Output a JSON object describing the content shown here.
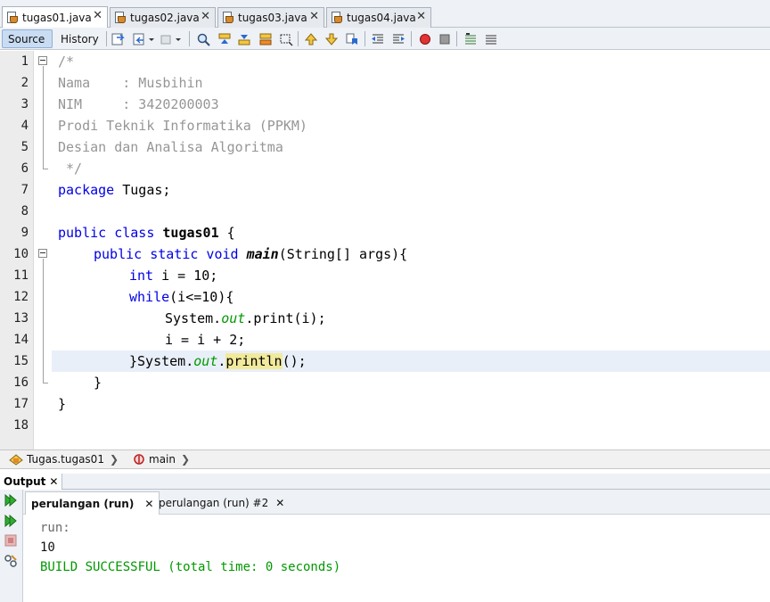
{
  "file_tabs": [
    {
      "label": "tugas01.java",
      "close": "✕"
    },
    {
      "label": "tugas02.java",
      "close": "✕"
    },
    {
      "label": "tugas03.java",
      "close": "✕"
    },
    {
      "label": "tugas04.java",
      "close": "✕"
    }
  ],
  "toolbar": {
    "source_label": "Source",
    "history_label": "History"
  },
  "editor": {
    "line_numbers": [
      "1",
      "2",
      "3",
      "4",
      "5",
      "6",
      "7",
      "8",
      "9",
      "10",
      "11",
      "12",
      "13",
      "14",
      "15",
      "16",
      "17",
      "18"
    ],
    "lines": {
      "l1": "/*",
      "l2": "Nama    : Musbihin",
      "l3": "NIM     : 3420200003",
      "l4": "Prodi Teknik Informatika (PPKM)",
      "l5": "Desian dan Analisa Algoritma",
      "l6": " */",
      "l7_kw": "package",
      "l7_rest": " Tugas;",
      "l9_kw": "public class",
      "l9_name": "tugas01",
      "l9_rest": " {",
      "l10_kw": "public static void",
      "l10_name": "main",
      "l10_rest": "(String[] args){",
      "l11_kw": "int",
      "l11_rest": " i = 10;",
      "l12_kw": "while",
      "l12_rest": "(i<=10){",
      "l13_a": "System.",
      "l13_out": "out",
      "l13_b": ".print(i);",
      "l14": "i = i + 2;",
      "l15_a": "}System.",
      "l15_out": "out",
      "l15_dot": ".",
      "l15_hl": "println",
      "l15_b": "();",
      "l16": "}",
      "l17": "}"
    }
  },
  "breadcrumb": {
    "class_label": "Tugas.tugas01",
    "method_label": "main",
    "sep": "❯"
  },
  "output": {
    "title": "Output",
    "close": "✕",
    "run_tabs": [
      {
        "label": "perulangan (run)",
        "close": "✕"
      },
      {
        "label": "perulangan (run) #2",
        "close": "✕"
      }
    ],
    "console": {
      "line1": "run:",
      "line2": "10",
      "line3": "BUILD SUCCESSFUL (total time: 0 seconds)"
    }
  },
  "colors": {
    "keyword": "#0000e6",
    "comment": "#969696",
    "field_italic": "#009900",
    "success": "#009900",
    "highlight": "#f1ea9c",
    "current_line": "#e9eff8"
  }
}
